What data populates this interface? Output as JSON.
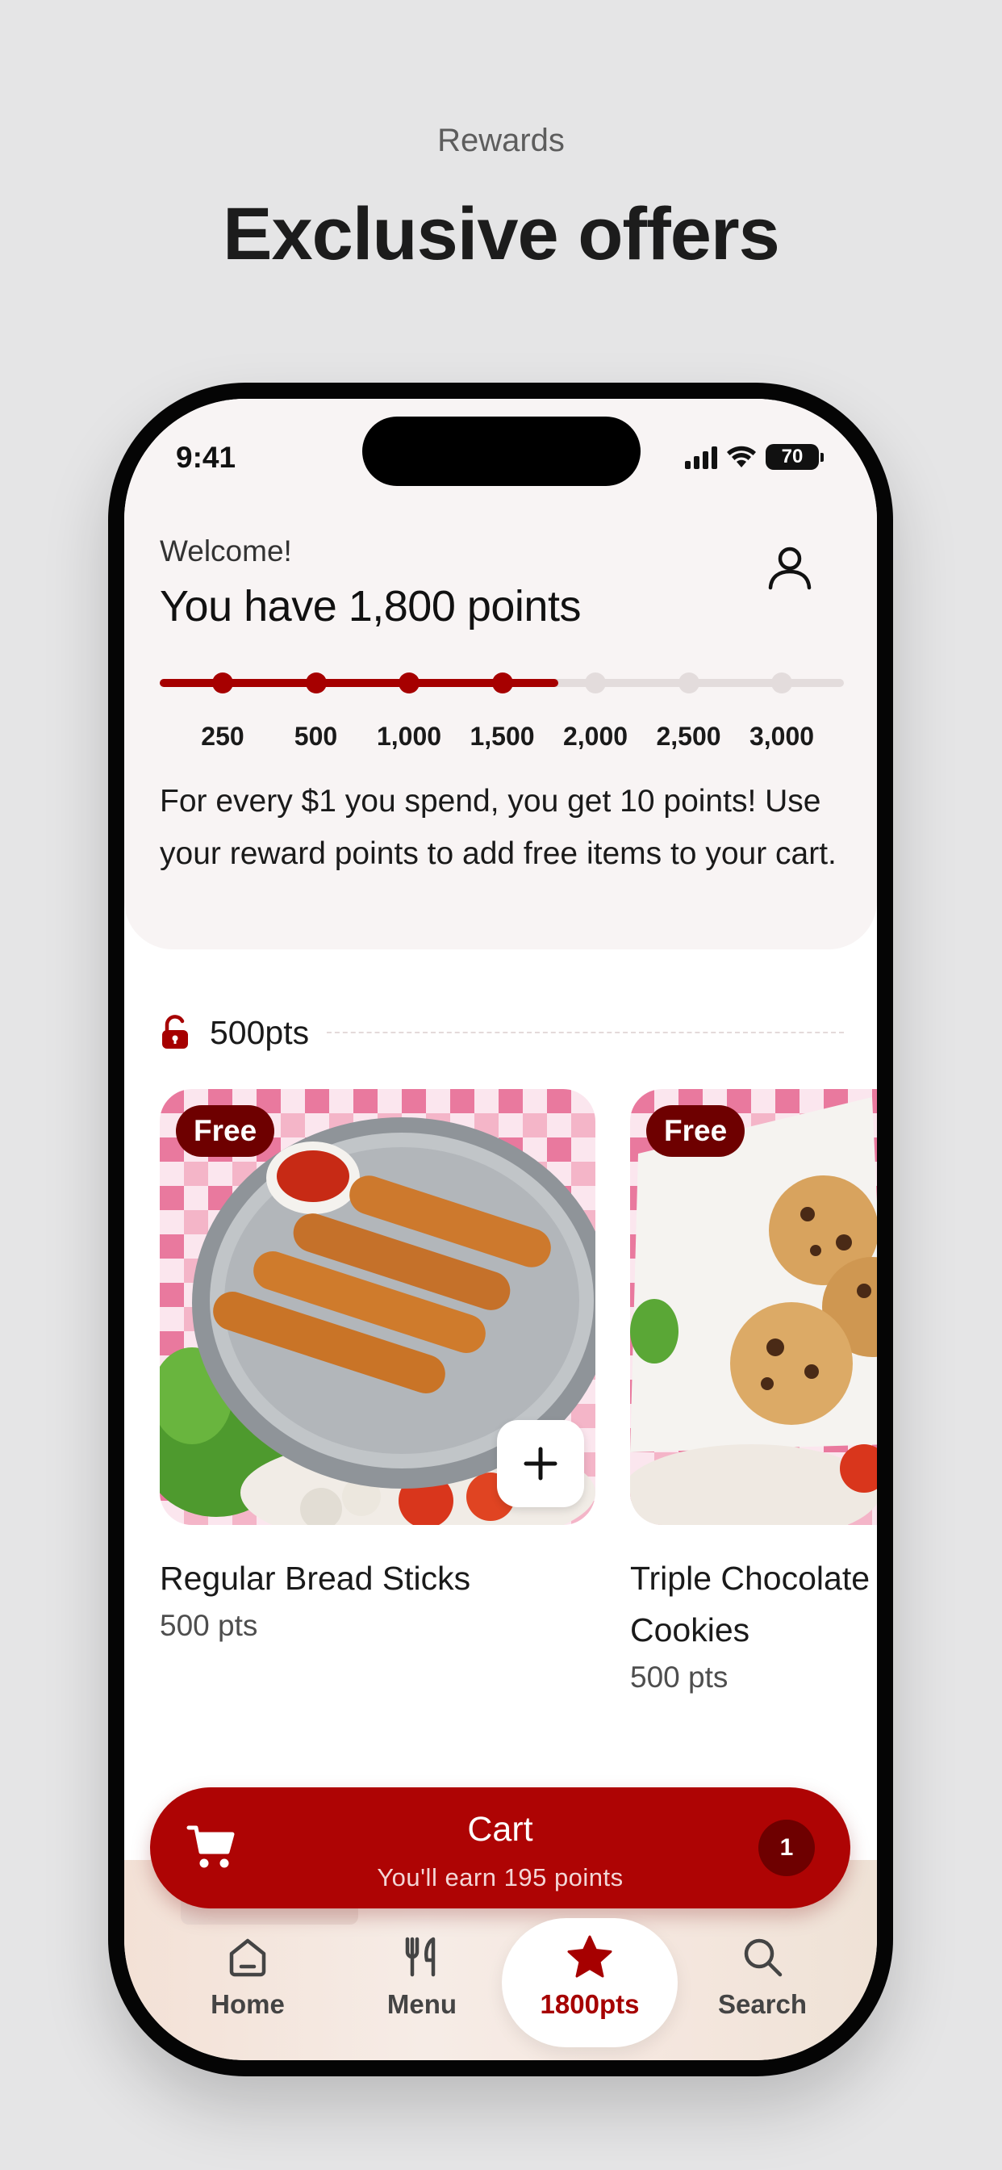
{
  "page": {
    "eyebrow": "Rewards",
    "headline": "Exclusive offers"
  },
  "status_bar": {
    "time": "9:41",
    "battery": "70"
  },
  "header": {
    "welcome": "Welcome!",
    "points_text": "You have 1,800 points",
    "profile_icon": "person-icon"
  },
  "progress": {
    "current_points": 1800,
    "max_points": 3000,
    "milestones": [
      "250",
      "500",
      "1,000",
      "1,500",
      "2,000",
      "2,500",
      "3,000"
    ],
    "fill_color": "#a60000",
    "track_color": "#e3dcdc"
  },
  "description": "For every $1 you spend, you get 10 points! Use your reward points to add free items to your cart.",
  "tier": {
    "label": "500pts",
    "icon": "unlock-icon"
  },
  "products": [
    {
      "badge": "Free",
      "name": "Regular Bread Sticks",
      "points": "500 pts",
      "add_icon": "plus-icon"
    },
    {
      "badge": "Free",
      "name": "Triple Chocolate Chip Cookies",
      "points": "500 pts"
    }
  ],
  "cart": {
    "title": "Cart",
    "subtitle": "You'll earn 195 points",
    "count": "1",
    "icon": "cart-icon"
  },
  "tabs": [
    {
      "label": "Home",
      "icon": "home-icon"
    },
    {
      "label": "Menu",
      "icon": "utensils-icon"
    },
    {
      "label": "1800pts",
      "icon": "star-icon"
    },
    {
      "label": "Search",
      "icon": "search-icon"
    }
  ],
  "colors": {
    "brand": "#ae0404",
    "brand_dark": "#6e0000",
    "background": "#e5e5e6"
  }
}
